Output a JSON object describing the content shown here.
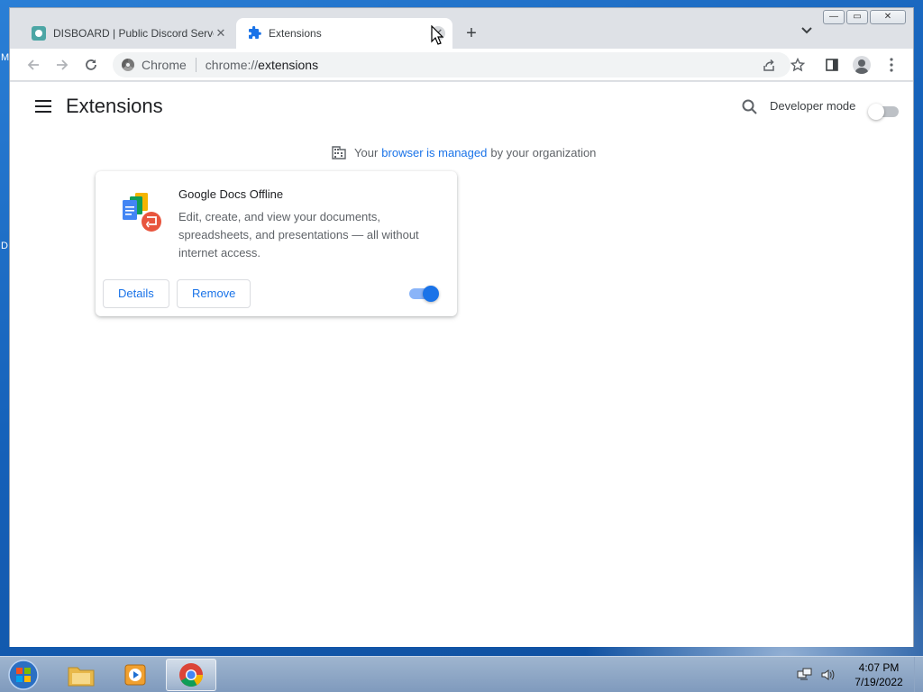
{
  "tabs": [
    {
      "title": "DISBOARD | Public Discord Serve",
      "icon": "disboard-favicon"
    },
    {
      "title": "Extensions",
      "icon": "puzzle-piece-icon"
    }
  ],
  "omnibox": {
    "site": "Chrome",
    "url_scheme": "chrome://",
    "url_path": "extensions"
  },
  "page": {
    "title": "Extensions",
    "developer_mode_label": "Developer mode",
    "developer_mode_on": false,
    "managed_prefix": "Your",
    "managed_link": "browser is managed",
    "managed_suffix": "by your organization"
  },
  "extension": {
    "name": "Google Docs Offline",
    "description": "Edit, create, and view your documents, spreadsheets, and presentations — all without internet access.",
    "details_label": "Details",
    "remove_label": "Remove",
    "enabled": true
  },
  "taskbar": {
    "time": "4:07 PM",
    "date": "7/19/2022"
  },
  "desktop_peek": {
    "left_char_top": "M",
    "left_char_mid": "D"
  },
  "colors": {
    "accent": "#1a73e8",
    "toggle_on_track": "#8ab4f8",
    "tab_strip": "#dee1e6"
  }
}
